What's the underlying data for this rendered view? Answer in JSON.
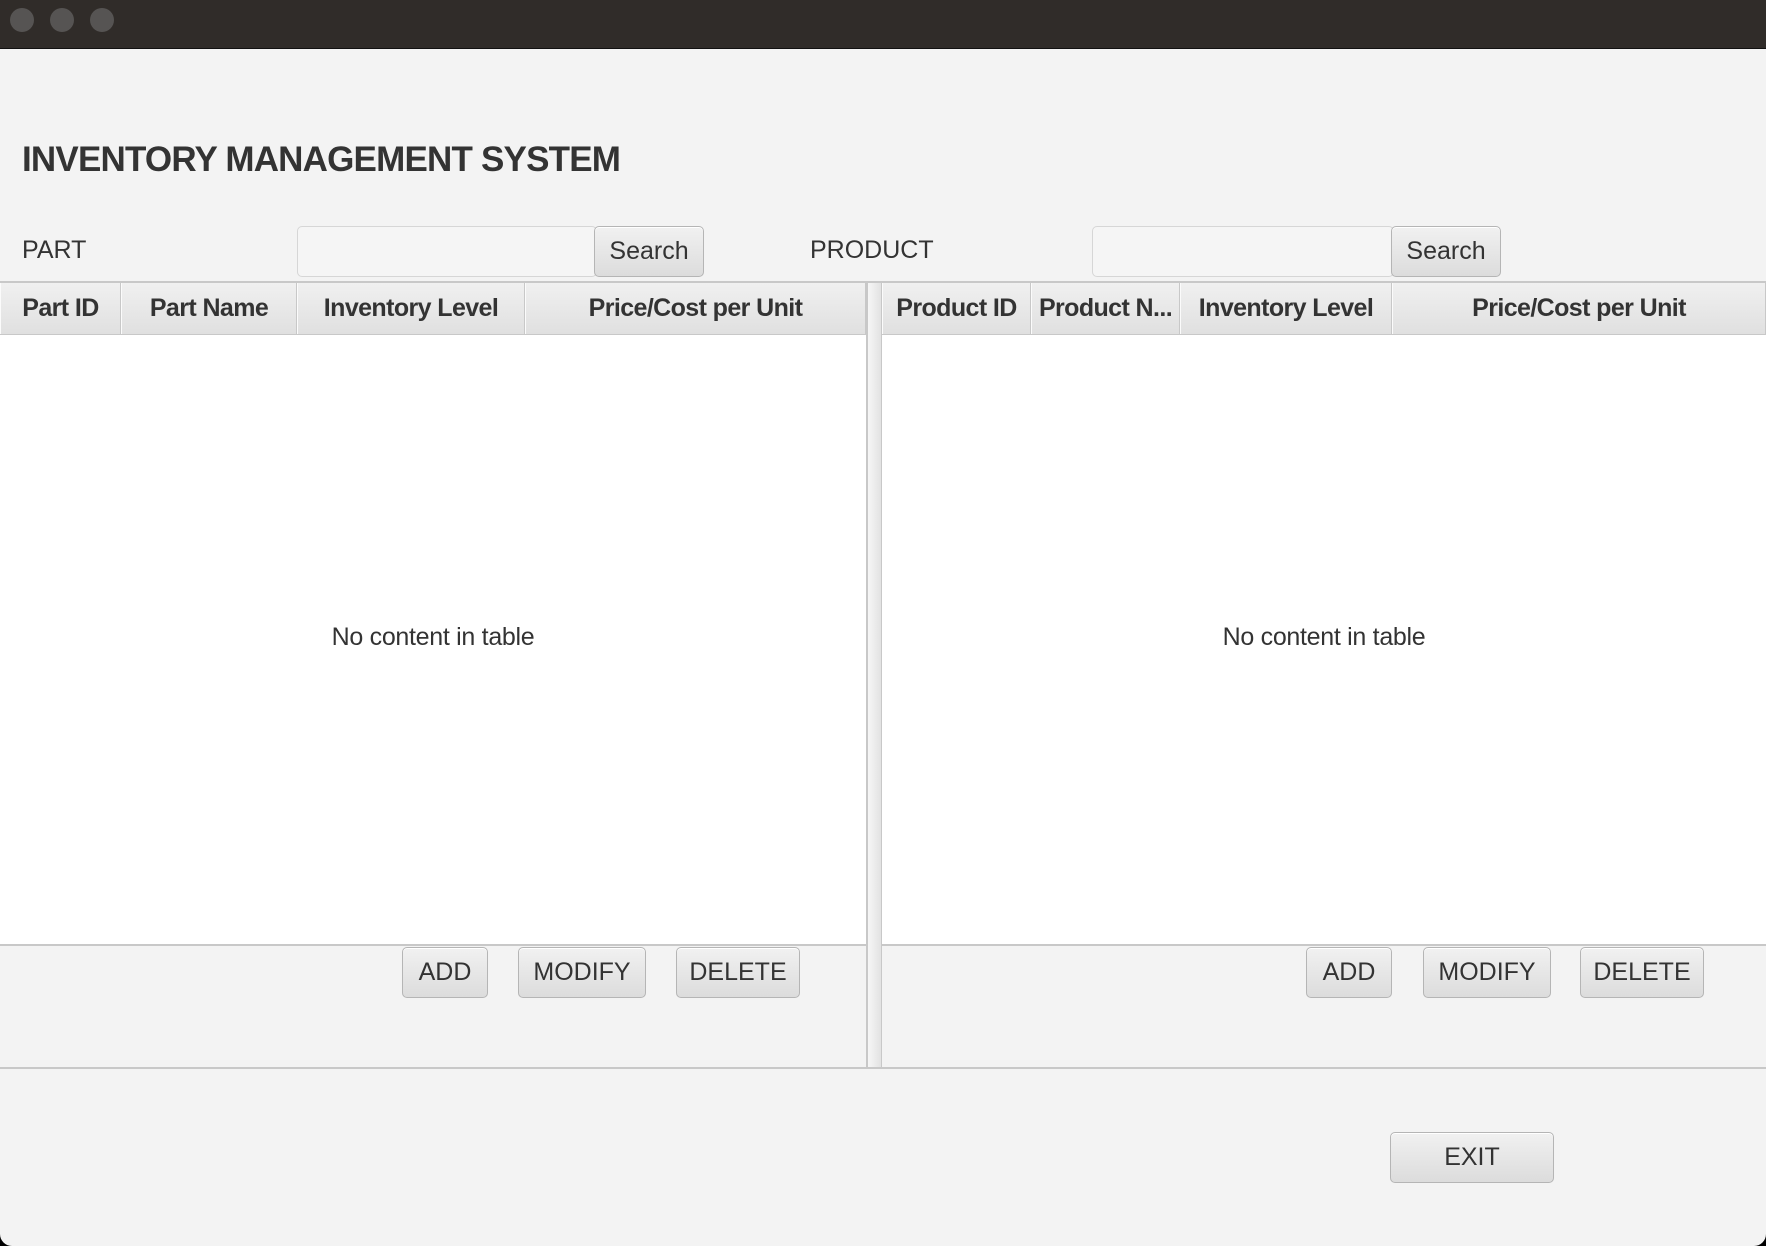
{
  "window": {
    "controls": [
      "close",
      "minimize",
      "maximize"
    ]
  },
  "app": {
    "title": "INVENTORY MANAGEMENT SYSTEM"
  },
  "parts": {
    "label": "PART",
    "search": {
      "value": "",
      "placeholder": "",
      "button_label": "Search"
    },
    "table": {
      "columns": [
        "Part ID",
        "Part Name",
        "Inventory Level",
        "Price/Cost per Unit"
      ],
      "rows": [],
      "empty_message": "No content in table"
    },
    "actions": {
      "add": "ADD",
      "modify": "MODIFY",
      "delete": "DELETE"
    }
  },
  "products": {
    "label": "PRODUCT",
    "search": {
      "value": "",
      "placeholder": "",
      "button_label": "Search"
    },
    "table": {
      "columns": [
        "Product ID",
        "Product N...",
        "Inventory Level",
        "Price/Cost per Unit"
      ],
      "rows": [],
      "empty_message": "No content in table"
    },
    "actions": {
      "add": "ADD",
      "modify": "MODIFY",
      "delete": "DELETE"
    }
  },
  "footer": {
    "exit": "EXIT"
  }
}
